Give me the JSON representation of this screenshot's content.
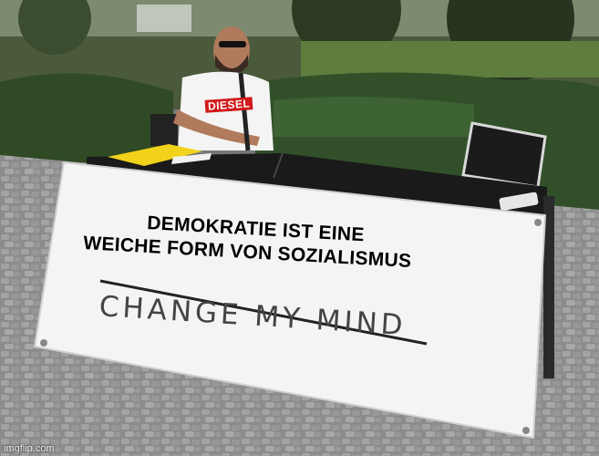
{
  "meme": {
    "caption_lines": [
      "DEMOKRATIE IST EINE",
      "WEICHE FORM VON SOZIALISMUS"
    ],
    "banner_slogan": "CHANGE MY MIND",
    "shirt_logo_text": "DIESEL",
    "watermark": "imgflip.com"
  },
  "colors": {
    "banner": "#f4f4f4",
    "table": "#1a1a1a",
    "hedge": "#2f4a24",
    "pavement": "#8a8a8a",
    "folder": "#f2d21a",
    "shirt_logo": "#d11a1a"
  }
}
